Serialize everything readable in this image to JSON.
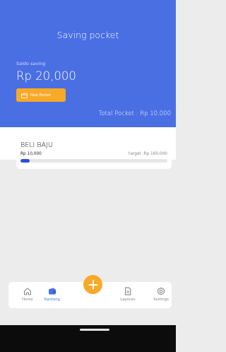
{
  "header": {
    "title": "Saving pocket",
    "saldo_label": "Saldo saving",
    "saldo_value": "Rp 20,000",
    "new_pocket_label": "New Pocket",
    "total_pocket": "Total Pocket : Rp 10,000"
  },
  "pockets": [
    {
      "name": "BELI BAJU",
      "amount": "Rp 10,000",
      "target": "target :Rp 160,000",
      "progress": 0.0625
    }
  ],
  "nav": {
    "items": [
      {
        "label": "Home",
        "icon": "home-icon",
        "active": false
      },
      {
        "label": "Kantong",
        "icon": "wallet-icon",
        "active": true
      },
      {
        "label": "Laporan",
        "icon": "document-icon",
        "active": false
      },
      {
        "label": "Settings",
        "icon": "gear-icon",
        "active": false
      }
    ],
    "fab_icon": "plus-icon"
  },
  "colors": {
    "primary": "#4a6fe3",
    "accent": "#f7a928",
    "progress": "#2f4fd8",
    "background": "#ececec"
  }
}
